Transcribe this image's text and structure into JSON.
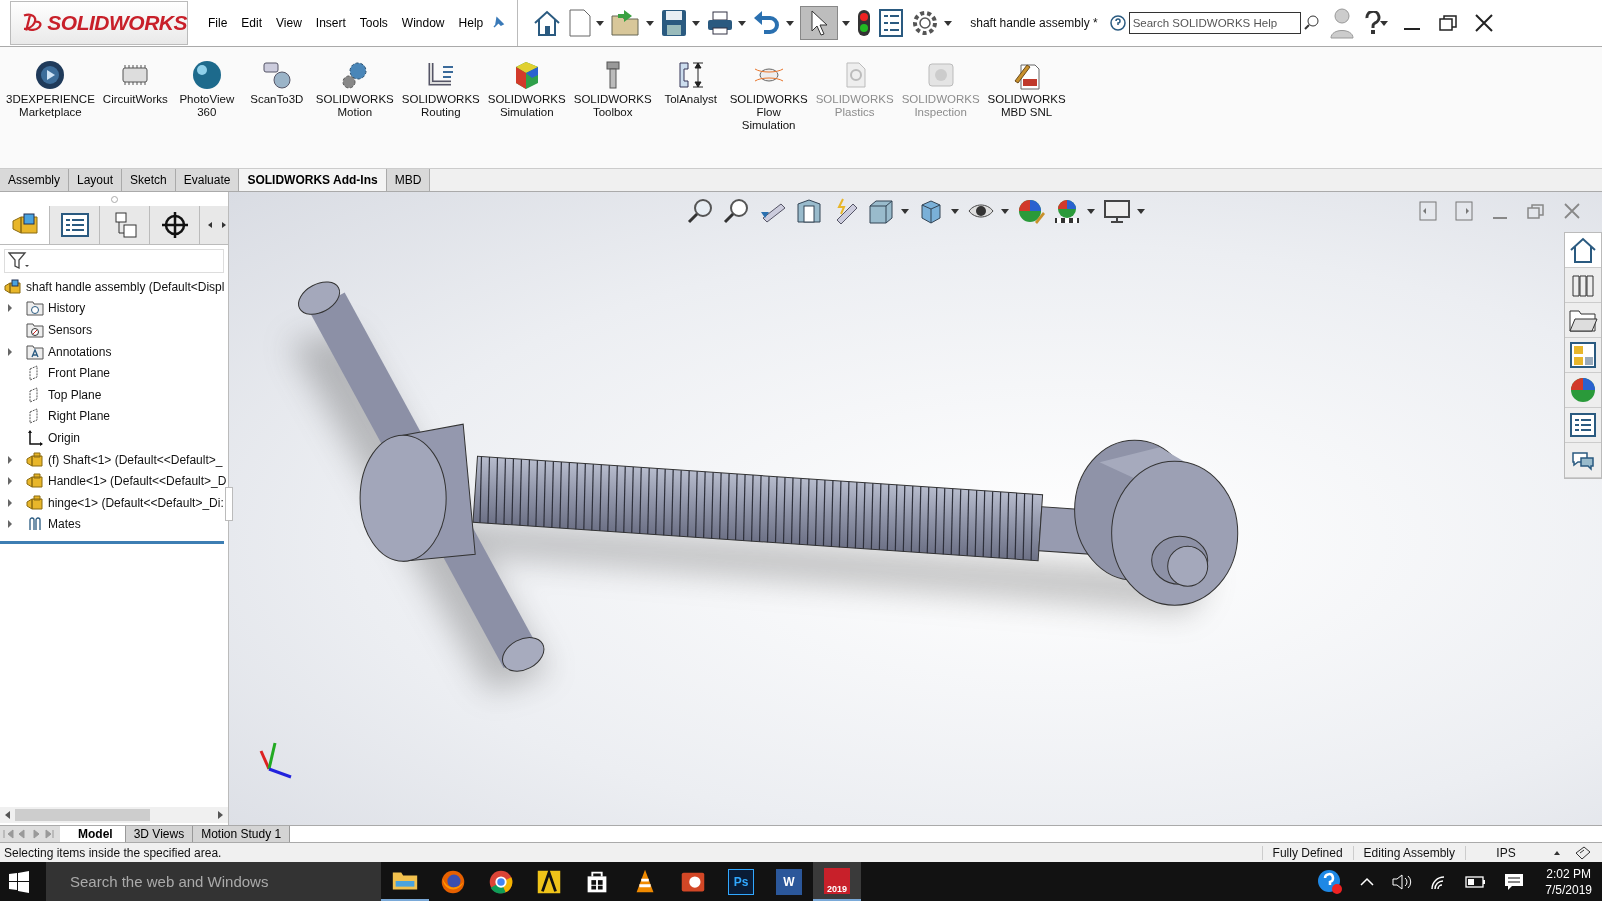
{
  "app": {
    "logo": "SOLIDWORKS",
    "menu": [
      "File",
      "Edit",
      "View",
      "Insert",
      "Tools",
      "Window",
      "Help"
    ],
    "document_title": "shaft handle assembly *",
    "help_search": {
      "placeholder": "Search SOLIDWORKS Help"
    }
  },
  "addins": [
    {
      "label": "3DEXPERIENCE\nMarketplace",
      "disabled": false
    },
    {
      "label": "CircuitWorks",
      "disabled": false
    },
    {
      "label": "PhotoView\n360",
      "disabled": false
    },
    {
      "label": "ScanTo3D",
      "disabled": false
    },
    {
      "label": "SOLIDWORKS\nMotion",
      "disabled": false
    },
    {
      "label": "SOLIDWORKS\nRouting",
      "disabled": false
    },
    {
      "label": "SOLIDWORKS\nSimulation",
      "disabled": false
    },
    {
      "label": "SOLIDWORKS\nToolbox",
      "disabled": false
    },
    {
      "label": "TolAnalyst",
      "disabled": false
    },
    {
      "label": "SOLIDWORKS\nFlow\nSimulation",
      "disabled": false
    },
    {
      "label": "SOLIDWORKS\nPlastics",
      "disabled": true
    },
    {
      "label": "SOLIDWORKS\nInspection",
      "disabled": true
    },
    {
      "label": "SOLIDWORKS\nMBD SNL",
      "disabled": false
    }
  ],
  "command_tabs": [
    {
      "label": "Assembly",
      "selected": false
    },
    {
      "label": "Layout",
      "selected": false
    },
    {
      "label": "Sketch",
      "selected": false
    },
    {
      "label": "Evaluate",
      "selected": false
    },
    {
      "label": "SOLIDWORKS Add-Ins",
      "selected": true
    },
    {
      "label": "MBD",
      "selected": false
    }
  ],
  "feature_tree": {
    "root": "shaft handle assembly  (Default<Displ",
    "items": [
      {
        "kind": "history",
        "label": "History",
        "has_children": true
      },
      {
        "kind": "sensors",
        "label": "Sensors",
        "has_children": false
      },
      {
        "kind": "annotations",
        "label": "Annotations",
        "has_children": true
      },
      {
        "kind": "plane",
        "label": "Front Plane",
        "has_children": false
      },
      {
        "kind": "plane",
        "label": "Top Plane",
        "has_children": false
      },
      {
        "kind": "plane",
        "label": "Right Plane",
        "has_children": false
      },
      {
        "kind": "origin",
        "label": "Origin",
        "has_children": false
      },
      {
        "kind": "part",
        "label": "(f) Shaft<1> (Default<<Default>_",
        "has_children": true
      },
      {
        "kind": "part",
        "label": "Handle<1> (Default<<Default>_D",
        "has_children": true
      },
      {
        "kind": "part",
        "label": "hinge<1> (Default<<Default>_Di:",
        "has_children": true
      },
      {
        "kind": "mates",
        "label": "Mates",
        "has_children": true
      }
    ]
  },
  "bottom_tabs": [
    {
      "label": "Model",
      "selected": true
    },
    {
      "label": "3D Views",
      "selected": false
    },
    {
      "label": "Motion Study 1",
      "selected": false
    }
  ],
  "status_bar": {
    "message": "Selecting items inside the specified area.",
    "fields": [
      "Fully Defined",
      "Editing Assembly",
      "IPS"
    ]
  },
  "taskbar": {
    "search": {
      "placeholder": "Search the web and Windows"
    },
    "apps": [
      {
        "running": true,
        "active": false
      },
      {
        "running": false,
        "active": false
      },
      {
        "running": false,
        "active": false
      },
      {
        "running": false,
        "active": false
      },
      {
        "running": false,
        "active": false
      },
      {
        "running": false,
        "active": false
      },
      {
        "running": false,
        "active": false
      },
      {
        "running": false,
        "active": false,
        "label": "Ps"
      },
      {
        "running": false,
        "active": false,
        "label": "W"
      },
      {
        "running": true,
        "active": true,
        "label": "2019"
      }
    ],
    "time": "2:02 PM",
    "date": "7/5/2019"
  }
}
